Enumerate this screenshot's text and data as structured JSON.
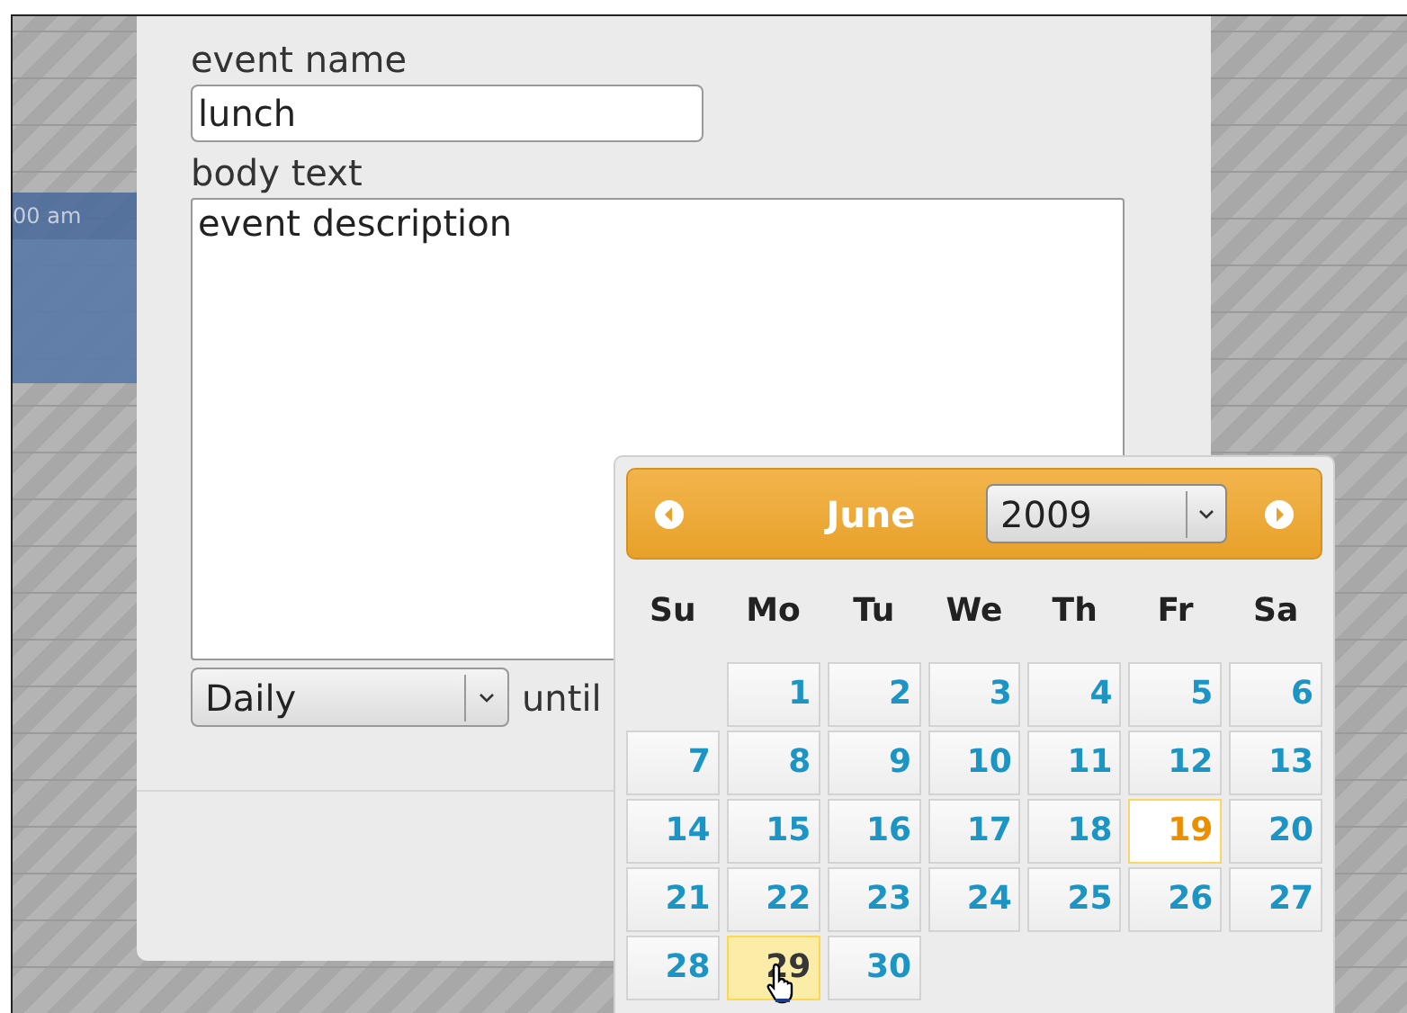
{
  "background": {
    "event": {
      "time": "00 am"
    }
  },
  "form": {
    "event_name": {
      "label": "event name",
      "value": "lunch"
    },
    "body_text": {
      "label": "body text",
      "value": "event description"
    },
    "repeat": {
      "value": "Daily"
    },
    "until_label": "until"
  },
  "datepicker": {
    "month": "June",
    "year": "2009",
    "weekdays": [
      "Su",
      "Mo",
      "Tu",
      "We",
      "Th",
      "Fr",
      "Sa"
    ],
    "weeks": [
      {
        "right_aligned": true,
        "days": [
          {
            "day": "1",
            "today": false,
            "selected": false
          },
          {
            "day": "2",
            "today": false,
            "selected": false
          },
          {
            "day": "3",
            "today": false,
            "selected": false
          },
          {
            "day": "4",
            "today": false,
            "selected": false
          },
          {
            "day": "5",
            "today": false,
            "selected": false
          },
          {
            "day": "6",
            "today": false,
            "selected": false
          }
        ]
      },
      {
        "days": [
          {
            "day": "7",
            "today": false,
            "selected": false
          },
          {
            "day": "8",
            "today": false,
            "selected": false
          },
          {
            "day": "9",
            "today": false,
            "selected": false
          },
          {
            "day": "10",
            "today": false,
            "selected": false
          },
          {
            "day": "11",
            "today": false,
            "selected": false
          },
          {
            "day": "12",
            "today": false,
            "selected": false
          },
          {
            "day": "13",
            "today": false,
            "selected": false
          }
        ]
      },
      {
        "days": [
          {
            "day": "14",
            "today": false,
            "selected": false
          },
          {
            "day": "15",
            "today": false,
            "selected": false
          },
          {
            "day": "16",
            "today": false,
            "selected": false
          },
          {
            "day": "17",
            "today": false,
            "selected": false
          },
          {
            "day": "18",
            "today": false,
            "selected": false
          },
          {
            "day": "19",
            "today": true,
            "selected": false
          },
          {
            "day": "20",
            "today": false,
            "selected": false
          }
        ]
      },
      {
        "days": [
          {
            "day": "21",
            "today": false,
            "selected": false
          },
          {
            "day": "22",
            "today": false,
            "selected": false
          },
          {
            "day": "23",
            "today": false,
            "selected": false
          },
          {
            "day": "24",
            "today": false,
            "selected": false
          },
          {
            "day": "25",
            "today": false,
            "selected": false
          },
          {
            "day": "26",
            "today": false,
            "selected": false
          },
          {
            "day": "27",
            "today": false,
            "selected": false
          }
        ]
      },
      {
        "right_aligned": false,
        "days": [
          {
            "day": "28",
            "today": false,
            "selected": false
          },
          {
            "day": "29",
            "today": false,
            "selected": true
          },
          {
            "day": "30",
            "today": false,
            "selected": false
          }
        ]
      }
    ]
  }
}
